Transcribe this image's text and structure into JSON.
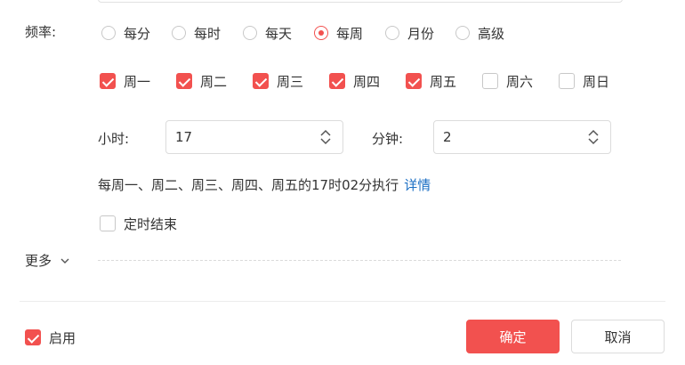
{
  "frequency": {
    "label": "频率:",
    "options": [
      {
        "label": "每分",
        "checked": false
      },
      {
        "label": "每时",
        "checked": false
      },
      {
        "label": "每天",
        "checked": false
      },
      {
        "label": "每周",
        "checked": true
      },
      {
        "label": "月份",
        "checked": false
      },
      {
        "label": "高级",
        "checked": false
      }
    ]
  },
  "weekdays": [
    {
      "label": "周一",
      "checked": true
    },
    {
      "label": "周二",
      "checked": true
    },
    {
      "label": "周三",
      "checked": true
    },
    {
      "label": "周四",
      "checked": true
    },
    {
      "label": "周五",
      "checked": true
    },
    {
      "label": "周六",
      "checked": false
    },
    {
      "label": "周日",
      "checked": false
    }
  ],
  "time": {
    "hour_label": "小时:",
    "hour_value": "17",
    "minute_label": "分钟:",
    "minute_value": "2"
  },
  "summary": {
    "text": "每周一、周二、周三、周四、周五的17时02分执行",
    "details_link": "详情"
  },
  "timed_end": {
    "label": "定时结束",
    "checked": false
  },
  "more": {
    "label": "更多"
  },
  "footer": {
    "enable_label": "启用",
    "enable_checked": true,
    "confirm_label": "确定",
    "cancel_label": "取消"
  },
  "colors": {
    "accent": "#f2514f",
    "link": "#1b6fc4"
  },
  "icons": [
    "stepper-arrows-icon",
    "chevron-down-icon",
    "checkmark-icon"
  ]
}
